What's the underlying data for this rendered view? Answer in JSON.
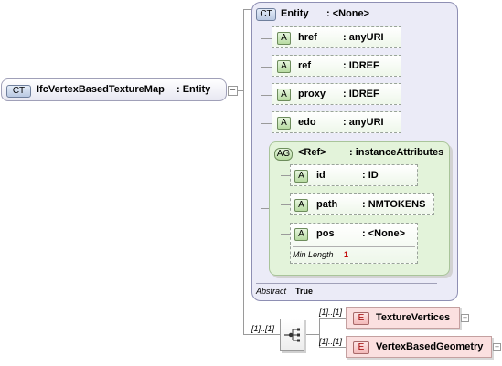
{
  "root": {
    "badge": "CT",
    "name": "IfcVertexBasedTextureMap",
    "type": ": Entity"
  },
  "complex_type": {
    "badge": "CT",
    "name": "Entity",
    "type": ": <None>",
    "attributes": [
      {
        "badge": "A",
        "name": "href",
        "type": ": anyURI"
      },
      {
        "badge": "A",
        "name": "ref",
        "type": ": IDREF"
      },
      {
        "badge": "A",
        "name": "proxy",
        "type": ": IDREF"
      },
      {
        "badge": "A",
        "name": "edo",
        "type": ": anyURI"
      }
    ],
    "attribute_group": {
      "badge": "AG",
      "name": "<Ref>",
      "type": ": instanceAttributes",
      "attributes": [
        {
          "badge": "A",
          "name": "id",
          "type": ": ID"
        },
        {
          "badge": "A",
          "name": "path",
          "type": ": NMTOKENS"
        },
        {
          "badge": "A",
          "name": "pos",
          "type": ": <None>",
          "facet_label": "Min Length",
          "facet_value": "1"
        }
      ]
    },
    "abstract_label": "Abstract",
    "abstract_value": "True"
  },
  "sequence": {
    "multiplicity": "[1]..[1]",
    "elements": [
      {
        "badge": "E",
        "name": "TextureVertices",
        "multiplicity": "[1]..[1]"
      },
      {
        "badge": "E",
        "name": "VertexBasedGeometry",
        "multiplicity": "[1]..[1]"
      }
    ]
  },
  "colors": {
    "ct_border": "#8e8fb3",
    "ct_fill": "#ebebf7",
    "ag_fill": "#e3f3da",
    "elem_fill": "#fbe0e0"
  }
}
